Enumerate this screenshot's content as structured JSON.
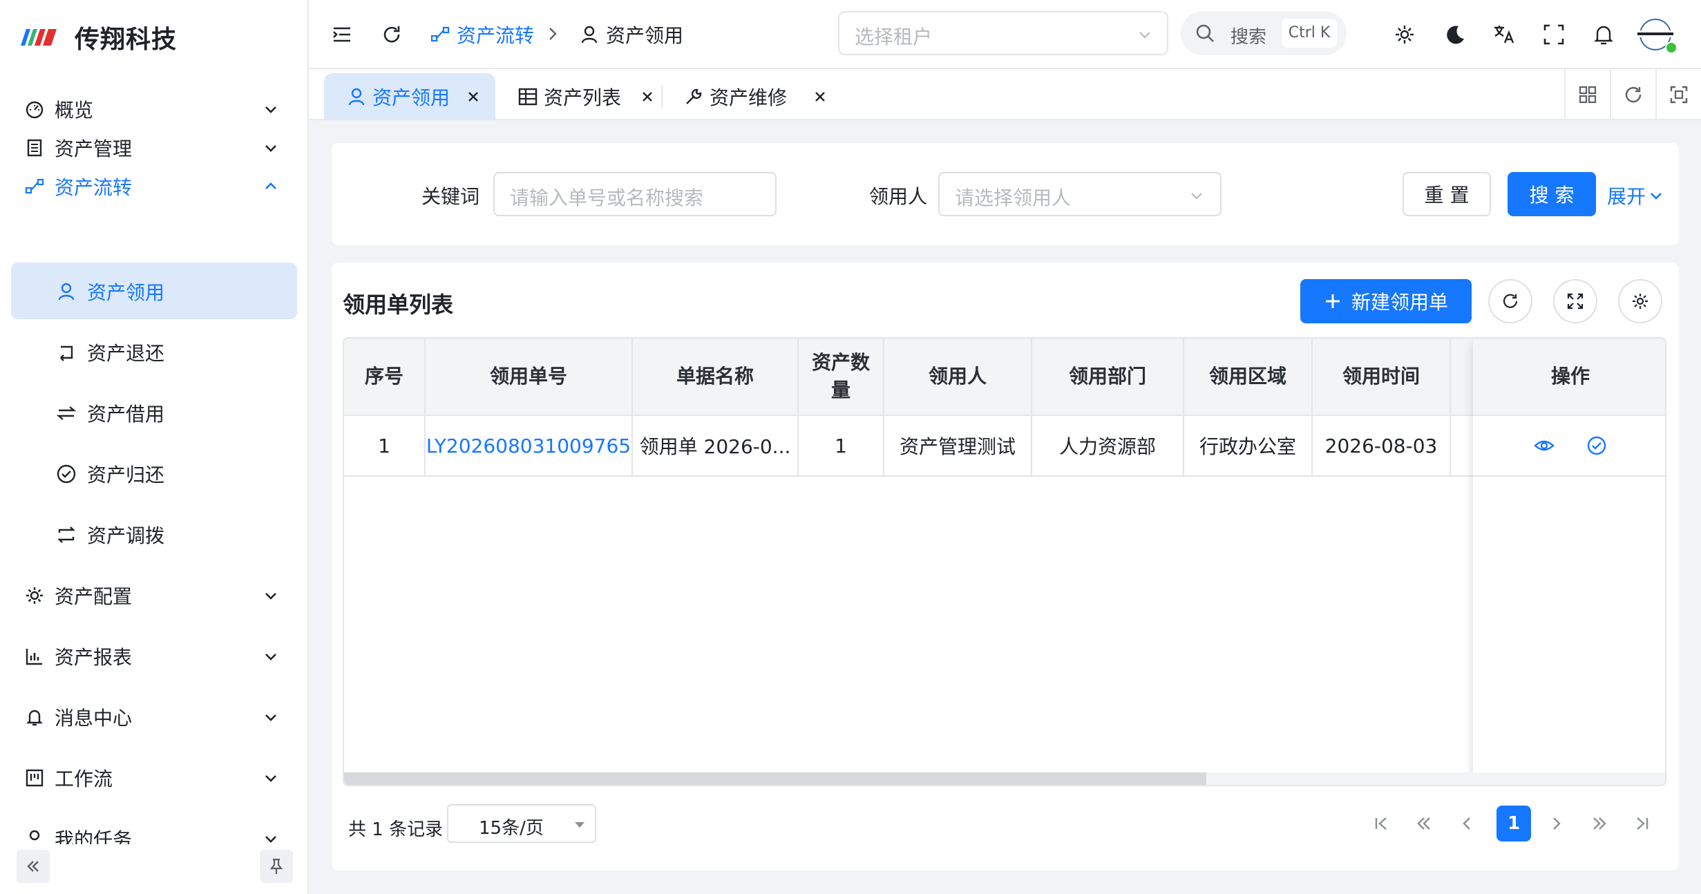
{
  "app": {
    "brand": "传翔科技"
  },
  "sidebar": {
    "items": [
      {
        "label": "概览",
        "icon": "dashboard-icon"
      },
      {
        "label": "资产管理",
        "icon": "document-icon"
      },
      {
        "label": "资产流转",
        "icon": "flow-icon",
        "expanded": true
      },
      {
        "label": "资产领用",
        "icon": "user-icon",
        "selected": true
      },
      {
        "label": "资产退还",
        "icon": "return-icon"
      },
      {
        "label": "资产借用",
        "icon": "exchange-icon"
      },
      {
        "label": "资产归还",
        "icon": "check-circle-icon"
      },
      {
        "label": "资产调拨",
        "icon": "transfer-icon"
      },
      {
        "label": "资产配置",
        "icon": "gear-icon"
      },
      {
        "label": "资产报表",
        "icon": "bar-chart-icon"
      },
      {
        "label": "消息中心",
        "icon": "bell-icon"
      },
      {
        "label": "工作流",
        "icon": "kanban-icon"
      },
      {
        "label": "我的任务",
        "icon": "task-icon"
      }
    ]
  },
  "header": {
    "breadcrumb": [
      {
        "label": "资产流转"
      },
      {
        "label": "资产领用"
      }
    ],
    "tenant_placeholder": "选择租户",
    "search_label": "搜索",
    "search_shortcut": "Ctrl K"
  },
  "tabs": [
    {
      "label": "资产领用",
      "active": true
    },
    {
      "label": "资产列表"
    },
    {
      "label": "资产维修"
    }
  ],
  "filter": {
    "keyword_label": "关键词",
    "keyword_placeholder": "请输入单号或名称搜索",
    "user_label": "领用人",
    "user_placeholder": "请选择领用人",
    "reset_label": "重 置",
    "search_label": "搜 索",
    "expand_label": "展开"
  },
  "table": {
    "title": "领用单列表",
    "new_button": "新建领用单",
    "columns": [
      "序号",
      "领用单号",
      "单据名称",
      "资产数量",
      "领用人",
      "领用部门",
      "领用区域",
      "领用时间",
      "",
      "操作"
    ],
    "rows": [
      {
        "index": "1",
        "number": "LY202608031009765",
        "name": "领用单 2026-0...",
        "quantity": "1",
        "user": "资产管理测试",
        "department": "人力资源部",
        "area": "行政办公室",
        "time": "2026-08-03"
      }
    ]
  },
  "pagination": {
    "total_text": "共 1 条记录",
    "page_size": "15条/页",
    "current_page": "1"
  },
  "colors": {
    "primary": "#1677ff",
    "selected_bg": "#dbe9fb"
  }
}
